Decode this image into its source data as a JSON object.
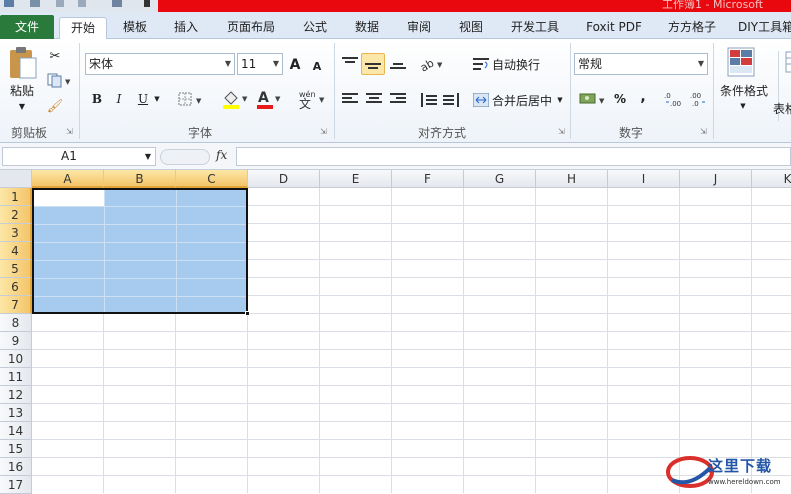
{
  "title_bar": {
    "title_fragment": "工作簿1 - Microsoft"
  },
  "tabs": [
    {
      "label": "文件",
      "kind": "file"
    },
    {
      "label": "开始",
      "kind": "active"
    },
    {
      "label": "模板"
    },
    {
      "label": "插入"
    },
    {
      "label": "页面布局"
    },
    {
      "label": "公式"
    },
    {
      "label": "数据"
    },
    {
      "label": "审阅"
    },
    {
      "label": "视图"
    },
    {
      "label": "开发工具"
    },
    {
      "label": "Foxit PDF"
    },
    {
      "label": "方方格子"
    },
    {
      "label": "DIY工具箱"
    }
  ],
  "ribbon": {
    "clipboard": {
      "paste_label": "粘贴",
      "group_label": "剪贴板"
    },
    "font": {
      "font_name": "宋体",
      "font_size": "11",
      "group_label": "字体",
      "bold": "B",
      "italic": "I",
      "underline": "U",
      "grow": "A",
      "shrink": "A",
      "phonetic": "wén"
    },
    "alignment": {
      "wrap_label": "自动换行",
      "merge_label": "合并后居中",
      "group_label": "对齐方式"
    },
    "number": {
      "format": "常规",
      "percent": "%",
      "comma": ",",
      "group_label": "数字"
    },
    "styles": {
      "conditional_label": "条件格式",
      "table_label": "表格"
    }
  },
  "formula_bar": {
    "name_box": "A1",
    "fx": "fx",
    "formula": ""
  },
  "columns": [
    "A",
    "B",
    "C",
    "D",
    "E",
    "F",
    "G",
    "H",
    "I",
    "J",
    "K"
  ],
  "rows": [
    "1",
    "2",
    "3",
    "4",
    "5",
    "6",
    "7",
    "8",
    "9",
    "10",
    "11",
    "12",
    "13",
    "14",
    "15",
    "16",
    "17"
  ],
  "selection": {
    "range": "A1:C7"
  },
  "watermark": {
    "text": "这里下载",
    "url": "www.hereldown.com"
  },
  "colors": {
    "file_tab": "#2a7a3b",
    "selection_fill": "#a6cbee",
    "header_selected": "#f4c56a",
    "title_red": "#e8080d"
  }
}
